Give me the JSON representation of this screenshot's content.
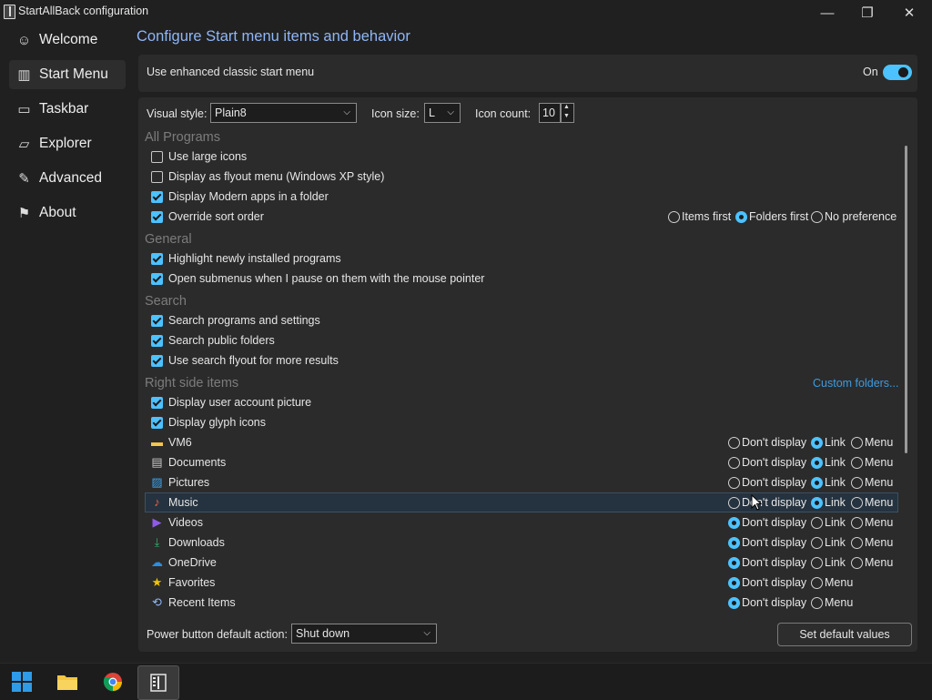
{
  "window": {
    "title": "StartAllBack configuration",
    "minimize": "—",
    "maximize": "❐",
    "close": "✕"
  },
  "sidebar": {
    "items": [
      {
        "label": "Welcome",
        "icon": "☺",
        "icon_name": "smile-icon"
      },
      {
        "label": "Start Menu",
        "icon": "▥",
        "icon_name": "start-menu-icon",
        "active": true
      },
      {
        "label": "Taskbar",
        "icon": "▭",
        "icon_name": "taskbar-icon"
      },
      {
        "label": "Explorer",
        "icon": "▱",
        "icon_name": "folder-icon"
      },
      {
        "label": "Advanced",
        "icon": "✎",
        "icon_name": "wrench-icon"
      },
      {
        "label": "About",
        "icon": "⚑",
        "icon_name": "about-icon"
      }
    ]
  },
  "page": {
    "heading": "Configure Start menu items and behavior",
    "enhanced": {
      "label": "Use enhanced classic start menu",
      "state": "On"
    },
    "visual_style": {
      "label": "Visual style:",
      "value": "Plain8"
    },
    "icon_size": {
      "label": "Icon size:",
      "value": "L"
    },
    "icon_count": {
      "label": "Icon count:",
      "value": "10"
    },
    "sections": {
      "all_programs": "All Programs",
      "general": "General",
      "search": "Search",
      "right_side": "Right side items"
    },
    "custom_folders": "Custom folders...",
    "checkboxes": [
      {
        "label": "Use large icons",
        "checked": false
      },
      {
        "label": "Display as flyout menu (Windows XP style)",
        "checked": false
      },
      {
        "label": "Display Modern apps in a folder",
        "checked": true
      },
      {
        "label": "Override sort order",
        "checked": true
      },
      {
        "label": "Highlight newly installed programs",
        "checked": true
      },
      {
        "label": "Open submenus when I pause on them with the mouse pointer",
        "checked": true
      },
      {
        "label": "Search programs and settings",
        "checked": true
      },
      {
        "label": "Search public folders",
        "checked": true
      },
      {
        "label": "Use search flyout for more results",
        "checked": true
      },
      {
        "label": "Display user account picture",
        "checked": true
      },
      {
        "label": "Display glyph icons",
        "checked": true
      }
    ],
    "sort_order": {
      "options": [
        "Items first",
        "Folders first",
        "No preference"
      ],
      "selected": "Folders first"
    },
    "right_items": [
      {
        "label": "VM6",
        "icon_name": "folder-icon",
        "icon_color": "#f2c94c",
        "options": [
          "Don't display",
          "Link",
          "Menu"
        ],
        "selected": "Link"
      },
      {
        "label": "Documents",
        "icon_name": "documents-icon",
        "icon_color": "#c9c9c9",
        "options": [
          "Don't display",
          "Link",
          "Menu"
        ],
        "selected": "Link"
      },
      {
        "label": "Pictures",
        "icon_name": "pictures-icon",
        "icon_color": "#3fa2e8",
        "options": [
          "Don't display",
          "Link",
          "Menu"
        ],
        "selected": "Link"
      },
      {
        "label": "Music",
        "icon_name": "music-icon",
        "icon_color": "#e9604a",
        "options": [
          "Don't display",
          "Link",
          "Menu"
        ],
        "selected": "Link",
        "highlighted": true
      },
      {
        "label": "Videos",
        "icon_name": "videos-icon",
        "icon_color": "#8e5be8",
        "options": [
          "Don't display",
          "Link",
          "Menu"
        ],
        "selected": "Don't display"
      },
      {
        "label": "Downloads",
        "icon_name": "downloads-icon",
        "icon_color": "#33b06a",
        "options": [
          "Don't display",
          "Link",
          "Menu"
        ],
        "selected": "Don't display"
      },
      {
        "label": "OneDrive",
        "icon_name": "onedrive-icon",
        "icon_color": "#2b8ee0",
        "options": [
          "Don't display",
          "Link",
          "Menu"
        ],
        "selected": "Don't display"
      },
      {
        "label": "Favorites",
        "icon_name": "favorites-icon",
        "icon_color": "#f2c300",
        "options": [
          "Don't display",
          "Menu"
        ],
        "selected": "Don't display"
      },
      {
        "label": "Recent Items",
        "icon_name": "recent-items-icon",
        "icon_color": "#8fb6f5",
        "options": [
          "Don't display",
          "Menu"
        ],
        "selected": "Don't display"
      }
    ],
    "power": {
      "label": "Power button default action:",
      "value": "Shut down"
    },
    "default_button": "Set default values"
  },
  "colors": {
    "accent": "#4cc2ff",
    "link": "#3c9be0",
    "heading": "#8fb6f5"
  },
  "taskbar": [
    {
      "name": "windows-start-icon"
    },
    {
      "name": "file-explorer-icon"
    },
    {
      "name": "chrome-icon"
    },
    {
      "name": "startallback-icon",
      "active": true
    }
  ]
}
